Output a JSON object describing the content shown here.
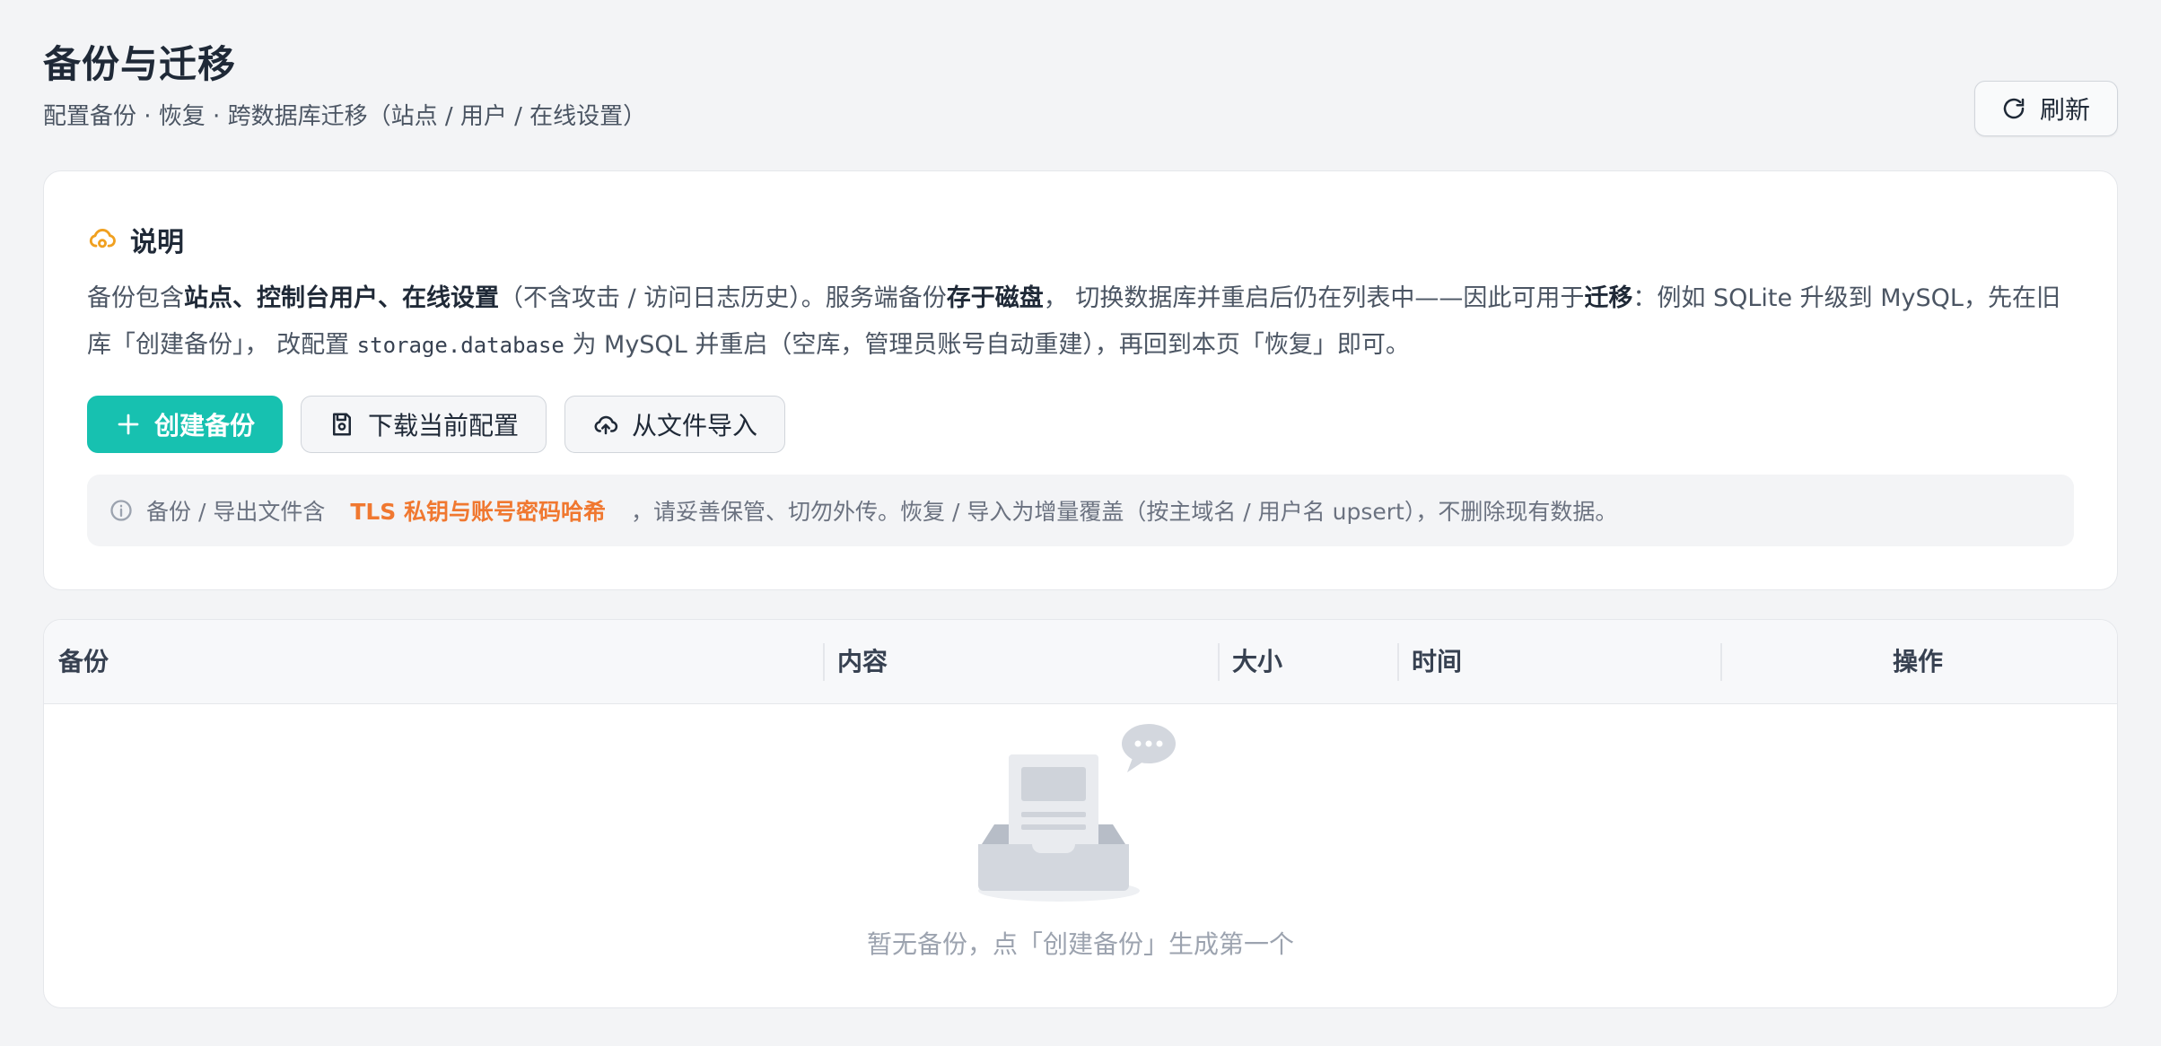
{
  "header": {
    "title": "备份与迁移",
    "subtitle": "配置备份 · 恢复 · 跨数据库迁移（站点 / 用户 / 在线设置）",
    "refresh_label": "刷新"
  },
  "info": {
    "title": "说明",
    "p1": "备份包含",
    "b1": "站点、控制台用户、在线设置",
    "p2": "（不含攻击 / 访问日志历史）。服务端备份",
    "b2": "存于磁盘",
    "p3": "， 切换数据库并重启后仍在列表中——因此可用于",
    "b3": "迁移",
    "p4": "：例如 SQLite 升级到 MySQL，先在旧库「创建备份」， 改配置 ",
    "code": "storage.database",
    "p5": " 为 MySQL 并重启（空库，管理员账号自动重建），再回到本页「恢复」即可。"
  },
  "actions": {
    "create": "创建备份",
    "download": "下载当前配置",
    "import": "从文件导入"
  },
  "notice": {
    "pre": "备份 / 导出文件含",
    "warn": "TLS 私钥与账号密码哈希",
    "post": "，请妥善保管、切勿外传。恢复 / 导入为增量覆盖（按主域名 / 用户名 upsert），不删除现有数据。"
  },
  "table": {
    "columns": [
      "备份",
      "内容",
      "大小",
      "时间",
      "操作"
    ],
    "rows": [],
    "empty_text": "暂无备份，点「创建备份」生成第一个"
  },
  "colors": {
    "accent": "#17c1b0",
    "warning": "#f07830",
    "info_icon": "#f0a020"
  },
  "icons": {
    "refresh": "refresh-icon",
    "info": "cloud-icon",
    "create": "plus-icon",
    "download": "save-icon",
    "import": "cloud-upload-icon",
    "notice": "info-circle-icon",
    "empty": "empty-inbox-icon"
  }
}
